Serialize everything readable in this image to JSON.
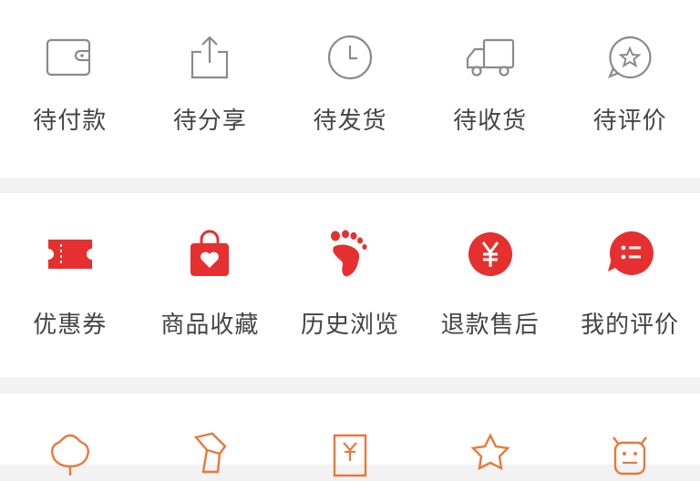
{
  "order_section": {
    "items": [
      {
        "label": "待付款",
        "icon": "wallet-icon"
      },
      {
        "label": "待分享",
        "icon": "share-icon"
      },
      {
        "label": "待发货",
        "icon": "clock-icon"
      },
      {
        "label": "待收货",
        "icon": "truck-icon"
      },
      {
        "label": "待评价",
        "icon": "star-bubble-icon"
      }
    ]
  },
  "service_section": {
    "items": [
      {
        "label": "优惠券",
        "icon": "coupon-icon"
      },
      {
        "label": "商品收藏",
        "icon": "shopping-bag-heart-icon"
      },
      {
        "label": "历史浏览",
        "icon": "footprint-icon"
      },
      {
        "label": "退款售后",
        "icon": "yen-circle-icon"
      },
      {
        "label": "我的评价",
        "icon": "comment-bubble-icon"
      }
    ]
  },
  "more_section": {
    "icons": [
      "flower-icon",
      "ticket-icon",
      "yen-card-icon",
      "star-icon",
      "cow-icon"
    ]
  },
  "colors": {
    "accent_red": "#e5302f",
    "outline_gray": "#8a8a8a",
    "orange": "#e8793a",
    "background": "#f2f2f2"
  }
}
